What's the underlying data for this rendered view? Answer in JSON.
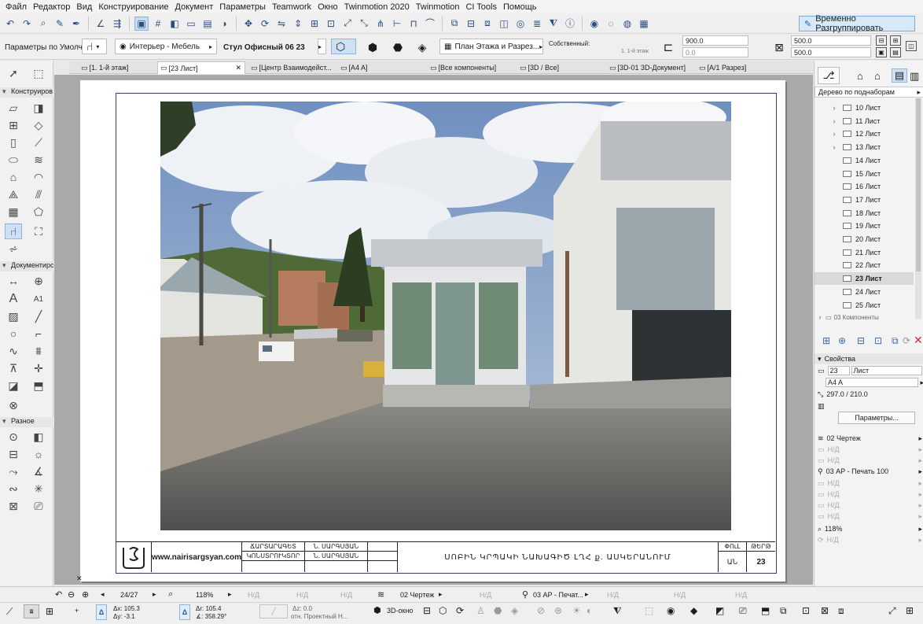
{
  "menu": [
    "Файл",
    "Редактор",
    "Вид",
    "Конструирование",
    "Документ",
    "Параметры",
    "Teamwork",
    "Окно",
    "Twinmotion 2020",
    "Twinmotion",
    "CI Tools",
    "Помощь"
  ],
  "regroup_label": "Временно Разгруппировать",
  "info_box": {
    "defaults_label": "Параметры по Умолчанию",
    "favorite": "Интерьер - Мебель",
    "object_name": "Стул Офисный 06 23",
    "view_mode": "План Этажа и Разрез...",
    "own_label": "Собственный:",
    "story_label": "1. 1-й этаж",
    "height_value": "900.0",
    "offset_value": "0.0",
    "width_value": "500.0",
    "depth_value": "500.0"
  },
  "tabs": [
    {
      "label": "[1. 1-й этаж]",
      "active": false
    },
    {
      "label": "[23 Лист]",
      "active": true
    },
    {
      "label": "[Центр Взаимодейст...",
      "active": false
    },
    {
      "label": "[A4 A]",
      "active": false
    },
    {
      "label": "[Все компоненты]",
      "active": false
    },
    {
      "label": "[3D / Все]",
      "active": false
    },
    {
      "label": "[3D-01 3D-Документ]",
      "active": false
    },
    {
      "label": "[A/1 Разрез]",
      "active": false
    }
  ],
  "toolbox": {
    "design_header": "Конструиров",
    "document_header": "Документиро",
    "more_header": "Разное",
    "text_tool": "A",
    "label_tool": "A1"
  },
  "title_block": {
    "website": "www.nairisargsyan.com",
    "role1": "ՃԱՐՏԱՐԱԳԵՏ",
    "name1": "Ն. ՍԱՐԳՍՅԱՆ",
    "role2": "ԿՈՆՍՏՐՈՒԿՏՈՐ",
    "name2": "Ն. ՍԱՐԳՍՅԱՆ",
    "project_title": "ՍՈԲԻՆ ԿՐՊԱԿԻ ՆԱԽԱԳԻԾ ԼՂՀ ք. ԱՍԿԵՐԱՆՈՒՄ",
    "stage_header": "ՓՈւԼ",
    "sheet_header": "ԹԵՐԹ",
    "stage": "ԱՆ",
    "sheet_no": "23"
  },
  "navigator": {
    "dropdown": "Дерево по поднаборам",
    "items": [
      {
        "label": "10 Лист",
        "expand": true
      },
      {
        "label": "11 Лист",
        "expand": true
      },
      {
        "label": "12 Лист",
        "expand": true
      },
      {
        "label": "13 Лист",
        "expand": true
      },
      {
        "label": "14 Лист",
        "expand": false
      },
      {
        "label": "15 Лист",
        "expand": false
      },
      {
        "label": "16 Лист",
        "expand": false
      },
      {
        "label": "17 Лист",
        "expand": false
      },
      {
        "label": "18 Лист",
        "expand": false
      },
      {
        "label": "19 Лист",
        "expand": false
      },
      {
        "label": "20 Лист",
        "expand": false
      },
      {
        "label": "21 Лист",
        "expand": false
      },
      {
        "label": "22 Лист",
        "expand": false
      },
      {
        "label": "23 Лист",
        "expand": false,
        "selected": true
      },
      {
        "label": "24 Лист",
        "expand": false
      },
      {
        "label": "25 Лист",
        "expand": false
      }
    ],
    "cut_item": "03 Компоненты"
  },
  "properties": {
    "header": "Свойства",
    "number": "23",
    "name": "Лист",
    "size": "A4 A",
    "dimensions": "297.0 / 210.0",
    "params_button": "Параметры...",
    "layer1": "02 Чертеж",
    "nd": "Н/Д",
    "layer2": "03 АР - Печать 100",
    "zoom": "118%"
  },
  "statusbar": {
    "page": "24/27",
    "zoom": "118%",
    "nd": "Н/Д",
    "layer": "02 Чертеж",
    "pen_set": "03 АР - Печат...",
    "dx": "Δx: 105.3",
    "dy": "Δy: -3.1",
    "dr": "Δr: 105.4",
    "angle": "∡: 358.29°",
    "dz": "Δz: 0.0",
    "ref": "отн. Проектный Н...",
    "view3d": "3D-окно"
  }
}
